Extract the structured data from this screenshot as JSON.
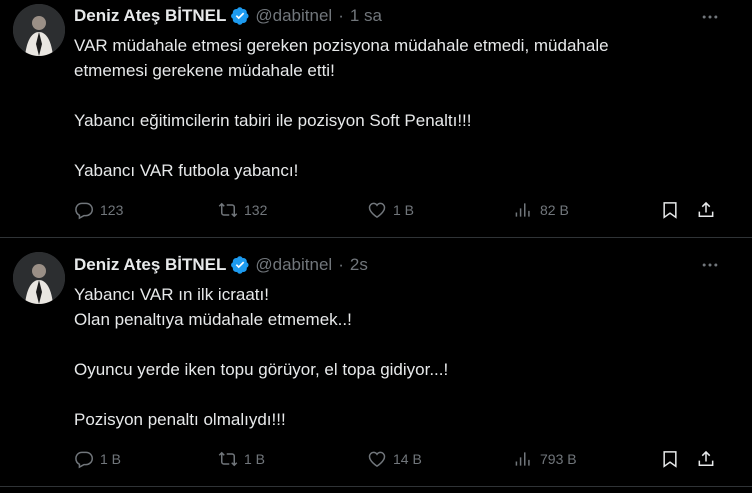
{
  "tweets": [
    {
      "author": {
        "name": "Deniz Ateş BİTNEL",
        "handle": "@dabitnel",
        "verified": true
      },
      "separator": "·",
      "time": "1 sa",
      "lines": [
        "VAR müdahale etmesi gereken pozisyona müdahale etmedi, müdahale",
        "etmemesi gerekene müdahale etti!",
        "",
        "Yabancı eğitimcilerin tabiri ile pozisyon Soft Penaltı!!!",
        "",
        "Yabancı VAR futbola yabancı!"
      ],
      "stats": {
        "replies": "123",
        "retweets": "132",
        "likes": "1 B",
        "views": "82 B"
      }
    },
    {
      "author": {
        "name": "Deniz Ateş BİTNEL",
        "handle": "@dabitnel",
        "verified": true
      },
      "separator": "·",
      "time": "2s",
      "lines": [
        "Yabancı VAR ın ilk icraatı!",
        "Olan penaltıya müdahale etmemek..!",
        "",
        "Oyuncu yerde iken topu görüyor, el topa gidiyor...!",
        "",
        "Pozisyon penaltı olmalıydı!!!"
      ],
      "stats": {
        "replies": "1 B",
        "retweets": "1 B",
        "likes": "14 B",
        "views": "793 B"
      }
    }
  ],
  "icons": {
    "verified": "verified-badge-icon",
    "more": "more-horizontal-icon",
    "reply": "reply-bubble-icon",
    "retweet": "retweet-icon",
    "like": "heart-icon",
    "views": "views-bar-chart-icon",
    "bookmark": "bookmark-icon",
    "share": "share-upload-icon"
  },
  "colors": {
    "background": "#000000",
    "text": "#e7e9ea",
    "muted": "#71767b",
    "verified": "#1d9bf0",
    "divider": "#2f3336"
  }
}
